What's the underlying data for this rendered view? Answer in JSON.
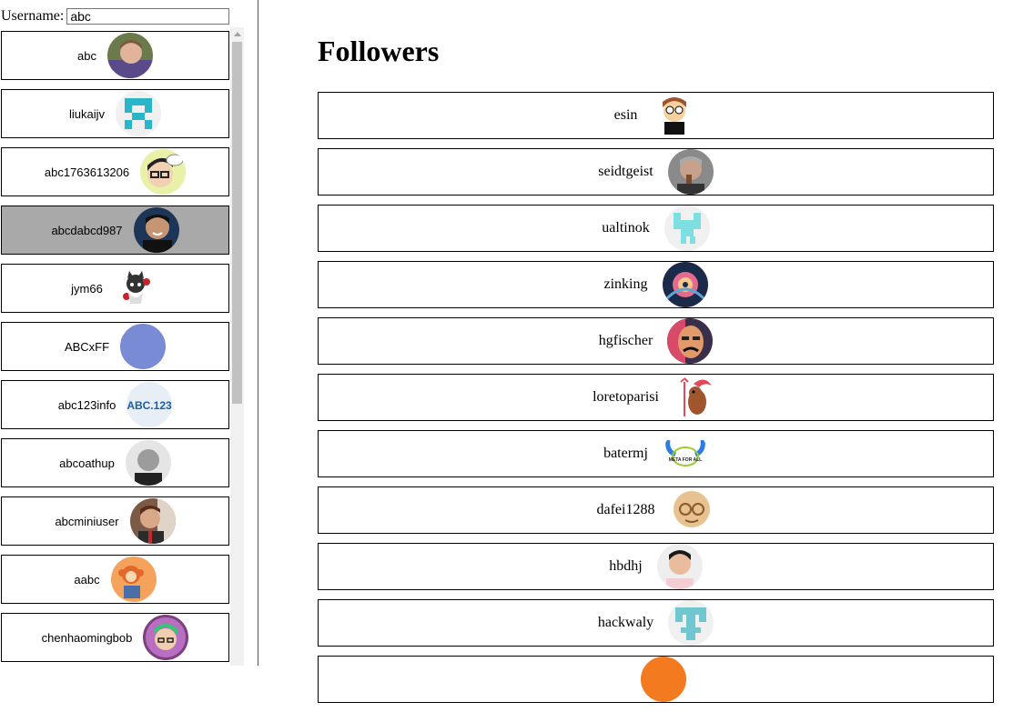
{
  "search": {
    "label": "Username:",
    "value": "abc"
  },
  "users": [
    {
      "login": "abc",
      "avatar": "photo-man-purple",
      "selected": false
    },
    {
      "login": "liukaijv",
      "avatar": "identicon-cyan",
      "selected": false
    },
    {
      "login": "abc1763613206",
      "avatar": "cartoon-glasses",
      "selected": false
    },
    {
      "login": "abcdabcd987",
      "avatar": "photo-man-smile",
      "selected": true
    },
    {
      "login": "jym66",
      "avatar": "octocat",
      "selected": false
    },
    {
      "login": "ABCxFF",
      "avatar": "solid-blue",
      "selected": false
    },
    {
      "login": "abc123info",
      "avatar": "abc123-logo",
      "selected": false
    },
    {
      "login": "abcoathup",
      "avatar": "photo-bald-man",
      "selected": false
    },
    {
      "login": "abcminiuser",
      "avatar": "photo-man-glasses",
      "selected": false
    },
    {
      "login": "aabc",
      "avatar": "cartoon-monkey",
      "selected": false
    },
    {
      "login": "chenhaomingbob",
      "avatar": "cartoon-green-hair",
      "selected": false
    }
  ],
  "main": {
    "title": "Followers"
  },
  "followers": [
    {
      "login": "esin",
      "avatar": "cartoon-southpark"
    },
    {
      "login": "seidtgeist",
      "avatar": "photo-man-gray"
    },
    {
      "login": "ualtinok",
      "avatar": "identicon-teal"
    },
    {
      "login": "zinking",
      "avatar": "art-flower"
    },
    {
      "login": "hgfischer",
      "avatar": "art-face-painting"
    },
    {
      "login": "loretoparisi",
      "avatar": "cartoon-devil-dog"
    },
    {
      "login": "batermj",
      "avatar": "meta-logo"
    },
    {
      "login": "dafei1288",
      "avatar": "cartoon-bald-glasses"
    },
    {
      "login": "hbdhj",
      "avatar": "photo-young-man"
    },
    {
      "login": "hackwaly",
      "avatar": "identicon-teal-2"
    },
    {
      "login": "",
      "avatar": "orange-avatar"
    }
  ]
}
